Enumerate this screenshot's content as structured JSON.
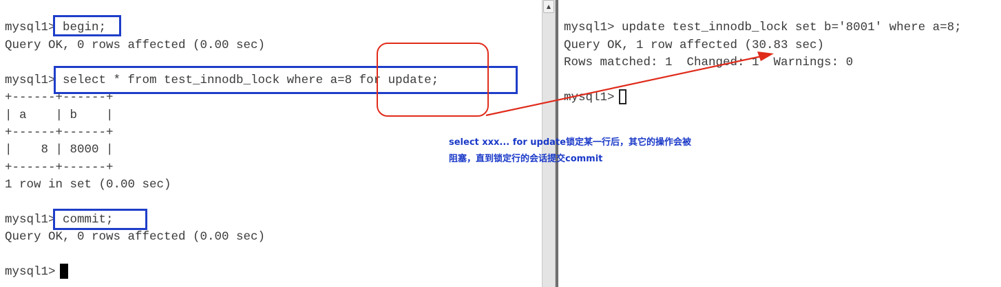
{
  "left_session": {
    "lines": [
      "mysql1> begin;",
      "Query OK, 0 rows affected (0.00 sec)",
      "",
      "mysql1> select * from test_innodb_lock where a=8 for update;",
      "+------+------+",
      "| a    | b    |",
      "+------+------+",
      "|    8 | 8000 |",
      "+------+------+",
      "1 row in set (0.00 sec)",
      "",
      "mysql1> commit;",
      "Query OK, 0 rows affected (0.00 sec)",
      "",
      "mysql1> "
    ]
  },
  "right_session": {
    "lines": [
      "mysql1> update test_innodb_lock set b='8001' where a=8;",
      "Query OK, 1 row affected (30.83 sec)",
      "Rows matched: 1  Changed: 1  Warnings: 0",
      "",
      "mysql1> "
    ]
  },
  "annotation": {
    "line1": "select xxx... for update锁定某一行后，其它的操作会被",
    "line2": "阻塞，直到锁定行的会话提交commit"
  },
  "scrollbar": {
    "up_glyph": "▲"
  },
  "colors": {
    "highlight_box": "#1e3ec9",
    "callout": "#e02b1b",
    "annotation_text": "#1a39c8",
    "terminal_text": "#3a3a3a"
  }
}
